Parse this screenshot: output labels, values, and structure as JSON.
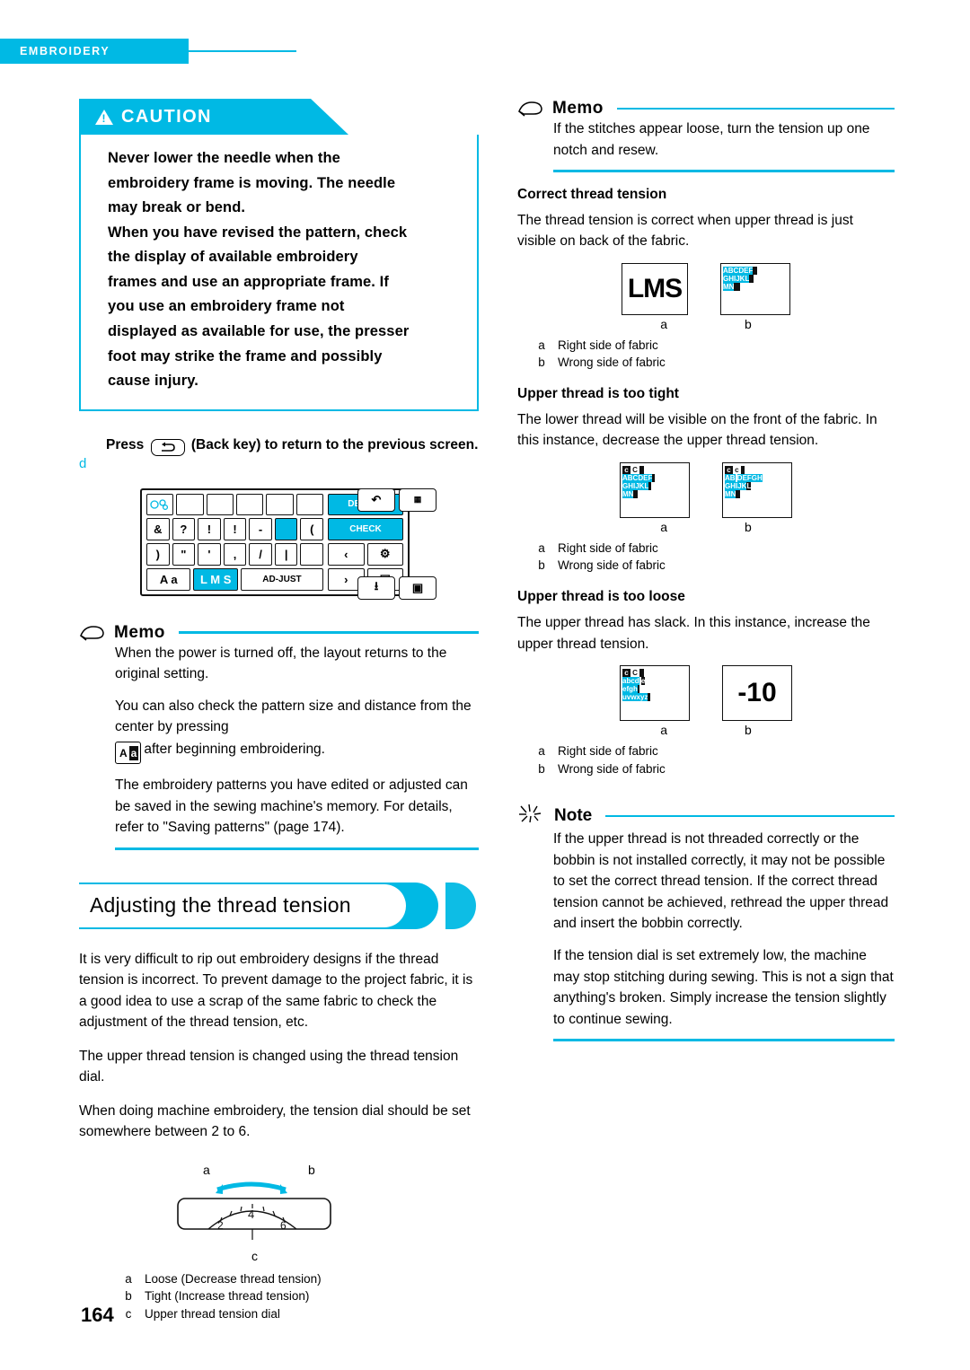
{
  "header": {
    "label": "EMBROIDERY"
  },
  "page_number": "164",
  "caution": {
    "title": "CAUTION",
    "icon": "warning-triangle-icon",
    "lines": [
      "Never lower the needle when the",
      "embroidery frame is moving. The needle",
      "may break or bend.",
      "When you have revised the pattern, check",
      "the display of available embroidery",
      "frames and use an appropriate frame. If",
      "you use an embroidery frame not",
      "displayed as available for use, the presser",
      "foot may strike the frame and possibly",
      "cause injury."
    ]
  },
  "step_d": {
    "letter": "d",
    "text_before": "Press",
    "key_icon": "back-arrow-icon",
    "text_after": "(Back key) to return to the previous screen."
  },
  "lcd": {
    "rows": [
      [
        "&",
        "?",
        "!",
        "!",
        "-",
        "",
        "(",
        ")"
      ],
      [
        ")",
        "\"",
        "'",
        ",",
        "/",
        "|",
        "",
        ""
      ]
    ],
    "bottom_keys": [
      "A a",
      "L M S",
      "AD-JUST"
    ],
    "right_keys": [
      "DELETE",
      "CHECK"
    ],
    "nav_icons": [
      "back-arrow-icon",
      "frame-select-icon",
      "left-arrow-icon",
      "rotate-icon",
      "right-arrow-icon",
      "page-icon",
      "save-icon",
      "memory-icon"
    ]
  },
  "memo_left": {
    "label": "Memo",
    "icon": "memo-icon",
    "paragraphs": [
      "When the power is turned off, the layout returns to the original setting.",
      "You can also check the pattern size and distance from the center by pressing",
      "after beginning embroidering.",
      "The embroidery patterns you have edited or adjusted can be saved in the sewing machine's memory. For details, refer to \"Saving patterns\" (page 174)."
    ]
  },
  "section": {
    "title": "Adjusting the thread tension",
    "paragraphs": [
      "It is very difficult to rip out embroidery designs if the thread tension is incorrect. To prevent damage to the project fabric, it is a good idea to use a scrap of the same fabric to check the adjustment of the thread tension, etc.",
      "The upper thread tension is changed using the thread tension dial.",
      "When doing machine embroidery, the tension dial should be set somewhere between 2 to 6."
    ]
  },
  "dial_figure": {
    "labels": {
      "a": "a",
      "b": "b",
      "c": "c"
    },
    "dial_numbers": [
      "2",
      "4",
      "6"
    ],
    "legend": [
      {
        "key": "a",
        "text": "Loose (Decrease thread tension)"
      },
      {
        "key": "b",
        "text": "Tight (Increase thread tension)"
      },
      {
        "key": "c",
        "text": "Upper thread tension dial"
      }
    ]
  },
  "memo_right": {
    "label": "Memo",
    "icon": "memo-icon",
    "text": "If the stitches appear loose, turn the tension up one notch and resew."
  },
  "correct": {
    "heading": "Correct thread tension",
    "text": "The thread tension is correct when upper thread is just visible on back of the fabric.",
    "fig_a_label": "a",
    "fig_b_label": "b",
    "swatch_a_text": "LMS",
    "swatch_b_text": "ABCDEF GHIJKL MN",
    "legend": [
      {
        "key": "a",
        "text": "Right side of fabric"
      },
      {
        "key": "b",
        "text": "Wrong side of fabric"
      }
    ]
  },
  "too_tight": {
    "heading": "Upper thread is too tight",
    "text": "The lower thread will be visible on the front of the fabric. In this instance, decrease the upper thread tension.",
    "fig_a_label": "a",
    "fig_b_label": "b",
    "swatch_a_text": "ABCDEF GHIJKL MN",
    "swatch_b_text": "ABC DEFGH IJKLMN",
    "legend": [
      {
        "key": "a",
        "text": "Right side of fabric"
      },
      {
        "key": "b",
        "text": "Wrong side of fabric"
      }
    ]
  },
  "too_loose": {
    "heading": "Upper thread is too loose",
    "text": "The upper thread has slack. In this instance, increase the upper thread tension.",
    "fig_a_label": "a",
    "fig_b_label": "b",
    "swatch_a_text": "abcd efgh uvwxyz",
    "swatch_b_text": "-10",
    "legend": [
      {
        "key": "a",
        "text": "Right side of fabric"
      },
      {
        "key": "b",
        "text": "Wrong side of fabric"
      }
    ]
  },
  "note": {
    "label": "Note",
    "icon": "note-burst-icon",
    "paragraphs": [
      "If the upper thread is not threaded correctly or the bobbin is not installed correctly, it may not be possible to set the correct thread tension. If the correct thread tension cannot be achieved, rethread the upper thread and insert the bobbin correctly.",
      "If the tension dial is set extremely low, the machine may stop stitching during sewing. This is not a sign that anything's broken. Simply increase the tension slightly to continue sewing."
    ]
  },
  "colors": {
    "accent": "#00b9e4",
    "ink": "#000000",
    "paper": "#ffffff"
  }
}
